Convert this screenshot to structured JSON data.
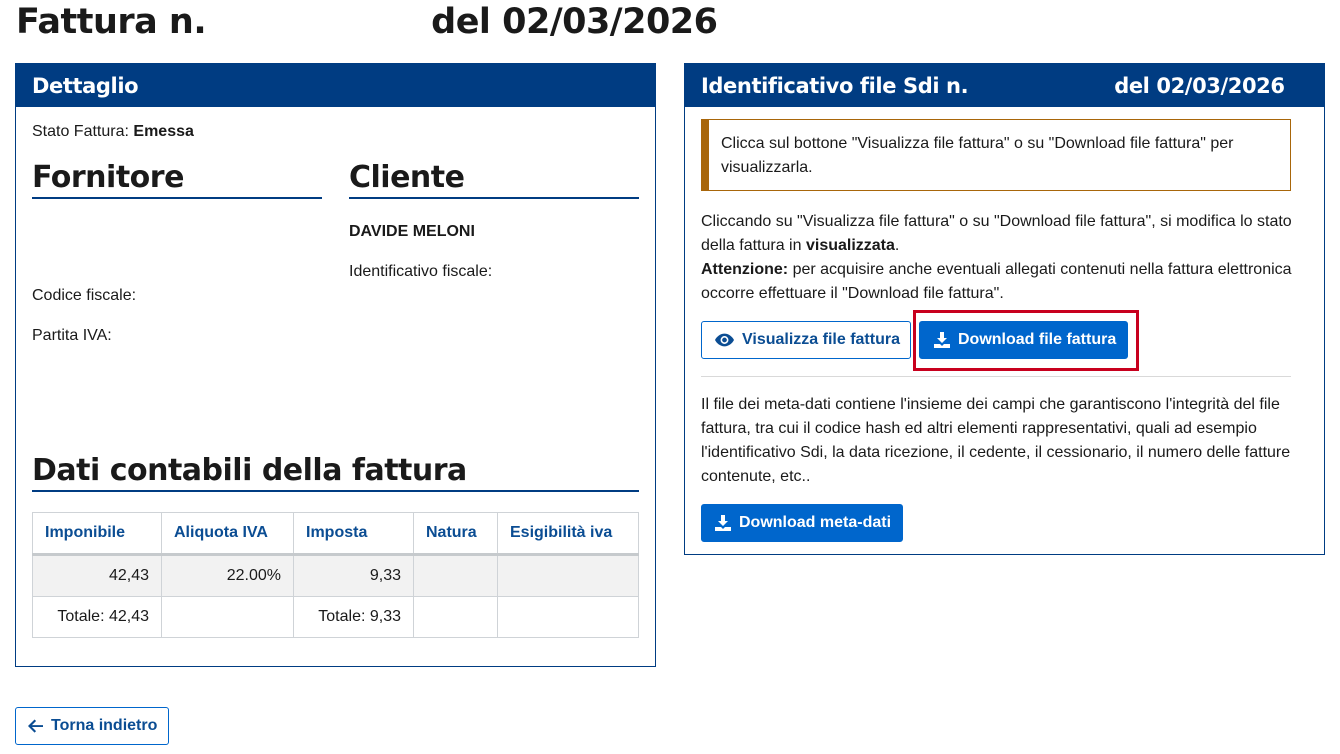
{
  "page": {
    "title_prefix": "Fattura n.",
    "title_suffix": "del 02/03/2026"
  },
  "detail": {
    "header": "Dettaglio",
    "status_label": "Stato Fattura:",
    "status_value": "Emessa",
    "supplier": {
      "heading": "Fornitore",
      "tax_code_label": "Codice fiscale:",
      "vat_label": "Partita IVA:"
    },
    "client": {
      "heading": "Cliente",
      "name": "DAVIDE MELONI",
      "fiscal_id_label": "Identificativo fiscale:"
    },
    "accounting": {
      "heading": "Dati contabili della fattura",
      "columns": [
        "Imponibile",
        "Aliquota IVA",
        "Imposta",
        "Natura",
        "Esigibilità iva"
      ],
      "rows": [
        [
          "42,43",
          "22.00%",
          "9,33",
          "",
          ""
        ],
        [
          "Totale: 42,43",
          "",
          "Totale: 9,33",
          "",
          ""
        ]
      ]
    }
  },
  "sdi": {
    "header_prefix": "Identificativo file Sdi n.",
    "header_suffix": "del 02/03/2026",
    "callout": "Clicca sul bottone \"Visualizza file fattura\" o su \"Download file fattura\" per visualizzarla.",
    "info_text": "Cliccando su \"Visualizza file fattura\" o su \"Download file fattura\", si modifica lo stato della fattura in",
    "info_bold": "visualizzata",
    "warning_label": "Attenzione:",
    "warning_text": "per acquisire anche eventuali allegati contenuti nella fattura elettronica occorre effettuare il \"Download file fattura\".",
    "view_button": "Visualizza file fattura",
    "download_button": "Download file fattura",
    "meta_text": "Il file dei meta-dati contiene l'insieme dei campi che garantiscono l'integrità del file fattura, tra cui il codice hash ed altri elementi rappresentativi, quali ad esempio l'identificativo Sdi, la data ricezione, il cedente, il cessionario, il numero delle fatture contenute, etc..",
    "meta_button": "Download meta-dati"
  },
  "back_button": "Torna indietro",
  "colors": {
    "primary": "#003c82",
    "button": "#0066cc",
    "warning_border": "#a8660a",
    "highlight": "#c8001e"
  },
  "icons": [
    "eye-icon",
    "download-icon",
    "arrow-left-icon"
  ]
}
